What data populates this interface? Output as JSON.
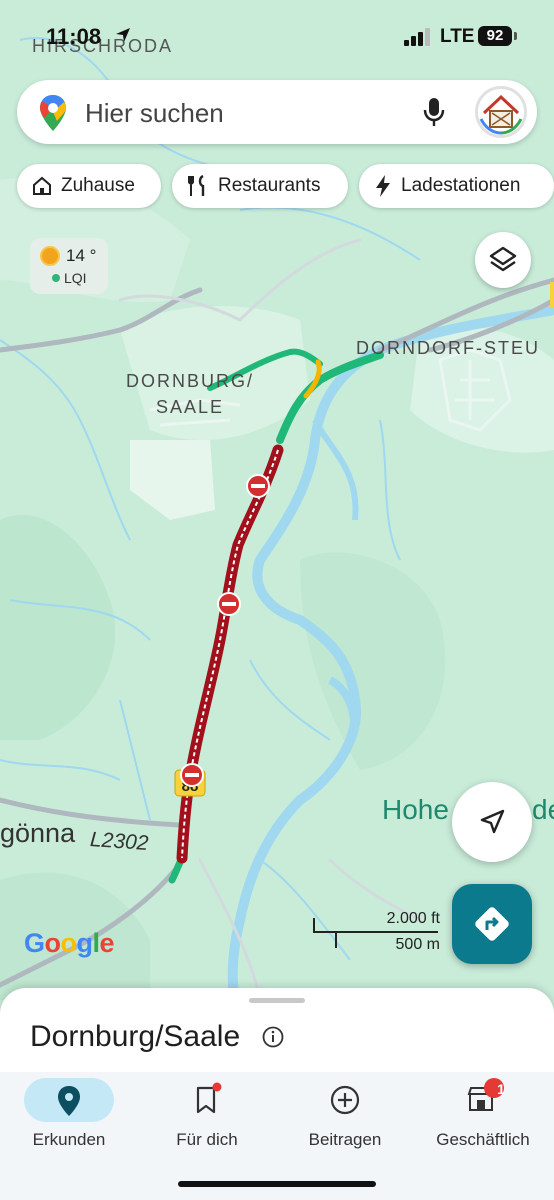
{
  "status_bar": {
    "time": "11:08",
    "network": "LTE",
    "battery": "92"
  },
  "search": {
    "placeholder": "Hier suchen"
  },
  "chips": [
    {
      "label": "Zuhause",
      "icon": "home-icon"
    },
    {
      "label": "Restaurants",
      "icon": "restaurant-icon"
    },
    {
      "label": "Ladestationen",
      "icon": "bolt-icon"
    }
  ],
  "weather": {
    "temperature": "14 °",
    "air_quality": "LQI"
  },
  "map": {
    "labels": {
      "hirschroda": "HIRSCHRODA",
      "dornburg": "DORNBURG/\nSAALE",
      "dorndorf": "DORNDORF-STEU",
      "gonna": "gönna",
      "road": "L2302",
      "hohe": "Hohe",
      "hohe_suffix": "de",
      "road_shield": "88"
    },
    "scale": {
      "imperial": "2.000 ft",
      "metric": "500 m"
    },
    "attribution": "Google",
    "colors": {
      "background": "#c9ecd9",
      "water": "#9fd8ef",
      "traffic_closure": "#a2101c",
      "traffic_free": "#1fb878",
      "traffic_slow": "#f4b400"
    }
  },
  "place": {
    "title": "Dornburg/Saale"
  },
  "bottom_nav": [
    {
      "label": "Erkunden",
      "icon": "explore-pin-icon",
      "active": true
    },
    {
      "label": "Für dich",
      "icon": "bookmark-icon",
      "badge_dot": true
    },
    {
      "label": "Beitragen",
      "icon": "add-circle-icon"
    },
    {
      "label": "Geschäftlich",
      "icon": "business-icon",
      "badge": "1"
    }
  ]
}
